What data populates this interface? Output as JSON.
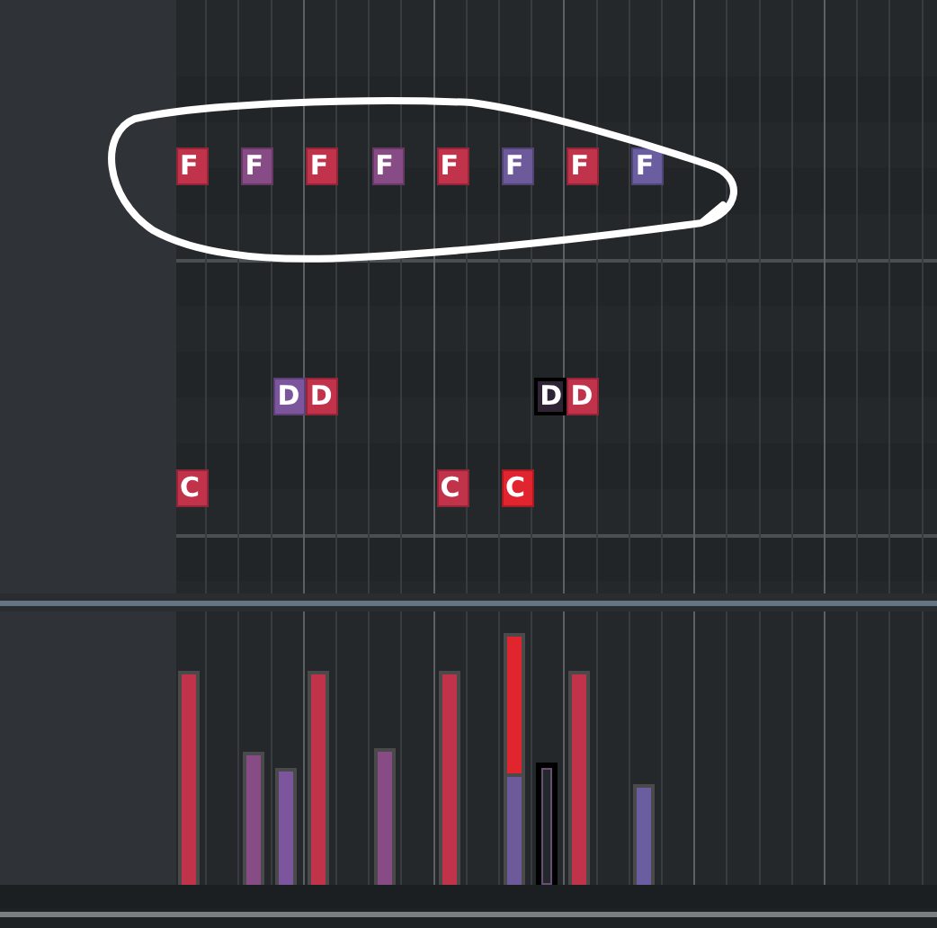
{
  "note_rows": [
    {
      "notes": [
        {
          "letter": "F",
          "color": "#c0334a",
          "selected": false
        },
        {
          "letter": "F",
          "color": "#874c85",
          "selected": false
        },
        {
          "letter": "F",
          "color": "#c0334a",
          "selected": false
        },
        {
          "letter": "F",
          "color": "#874c85",
          "selected": false
        },
        {
          "letter": "F",
          "color": "#c0334a",
          "selected": false
        },
        {
          "letter": "F",
          "color": "#6c5a9a",
          "selected": false
        },
        {
          "letter": "F",
          "color": "#c0334a",
          "selected": false
        },
        {
          "letter": "F",
          "color": "#6a5ea0",
          "selected": false
        }
      ]
    },
    {
      "notes": [
        {
          "letter": "D",
          "color": "#7c569c",
          "selected": false
        },
        {
          "letter": "D",
          "color": "#c0334a",
          "selected": false
        },
        {
          "letter": "D",
          "color": "#2e2433",
          "selected": true
        },
        {
          "letter": "D",
          "color": "#c0334a",
          "selected": false
        }
      ]
    },
    {
      "notes": [
        {
          "letter": "C",
          "color": "#c0334a",
          "selected": false
        },
        {
          "letter": "C",
          "color": "#c0334a",
          "selected": false
        },
        {
          "letter": "C",
          "color": "#e0252f",
          "selected": false
        }
      ]
    }
  ]
}
